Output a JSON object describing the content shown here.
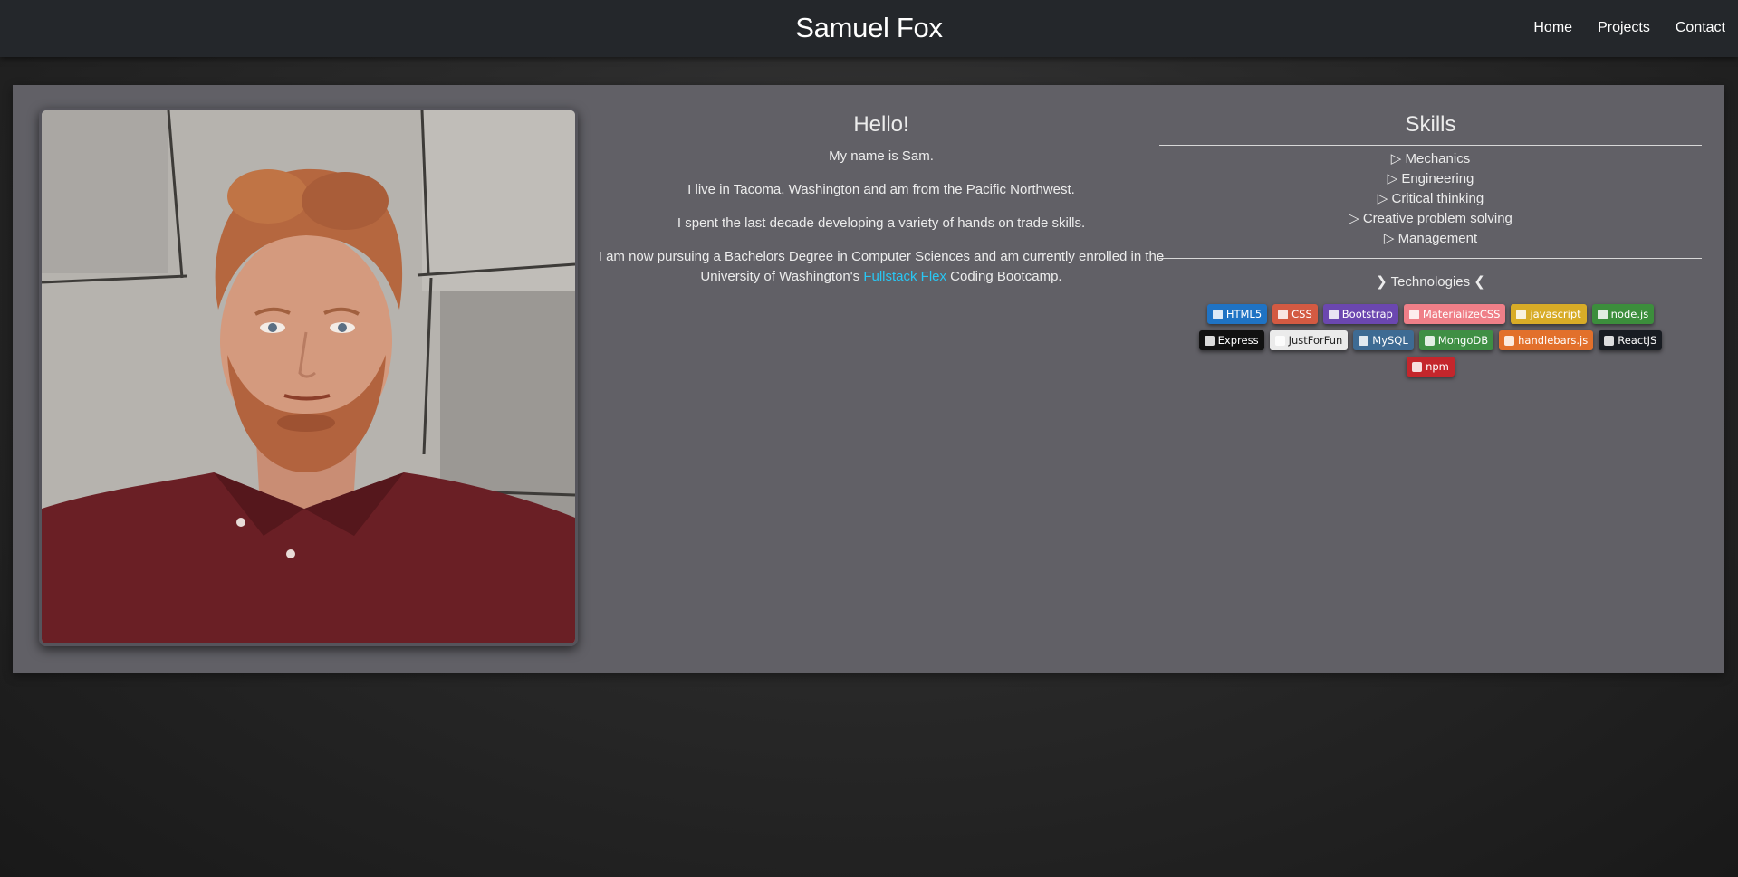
{
  "header": {
    "brand": "Samuel Fox",
    "nav": [
      "Home",
      "Projects",
      "Contact"
    ]
  },
  "about": {
    "title": "Hello!",
    "line1": "My name is Sam.",
    "line2": "I live in Tacoma, Washington and am from the Pacific Northwest.",
    "line3": "I spent the last decade developing a variety of hands on trade skills.",
    "line4_before": "I am now pursuing a Bachelors Degree in Computer Sciences and am currently enrolled in the University of Washington's ",
    "line4_link": "Fullstack Flex",
    "line4_after": " Coding Bootcamp."
  },
  "skills": {
    "title": "Skills",
    "items": [
      "▷ Mechanics",
      "▷ Engineering",
      "▷ Critical thinking",
      "▷ Creative problem solving",
      "▷ Management"
    ],
    "tech_title": "❯ Technologies ❮",
    "badges": [
      {
        "label": "HTML5",
        "color": "#1f73c4",
        "icon": "html5-icon"
      },
      {
        "label": "CSS",
        "color": "#d35a42",
        "icon": "css3-icon"
      },
      {
        "label": "Bootstrap",
        "color": "#6b47b0",
        "icon": "bootstrap-icon"
      },
      {
        "label": "MaterializeCSS",
        "color": "#ef7f88",
        "icon": "materialize-icon"
      },
      {
        "label": "javascript",
        "color": "#d8ac27",
        "icon": "javascript-icon"
      },
      {
        "label": "node.js",
        "color": "#3c8e3c",
        "icon": "nodejs-icon"
      },
      {
        "label": "Express",
        "color": "#111111",
        "icon": "express-icon"
      },
      {
        "label": "JustForFun",
        "color": "#ebebeb",
        "icon": "youtube-icon"
      },
      {
        "label": "MySQL",
        "color": "#3e6b93",
        "icon": "mysql-icon"
      },
      {
        "label": "MongoDB",
        "color": "#3f8f44",
        "icon": "mongodb-icon"
      },
      {
        "label": "handlebars.js",
        "color": "#e2702b",
        "icon": "handlebars-icon"
      },
      {
        "label": "ReactJS",
        "color": "#181c22",
        "icon": "react-icon"
      },
      {
        "label": "npm",
        "color": "#c4262c",
        "icon": "npm-icon"
      }
    ]
  }
}
